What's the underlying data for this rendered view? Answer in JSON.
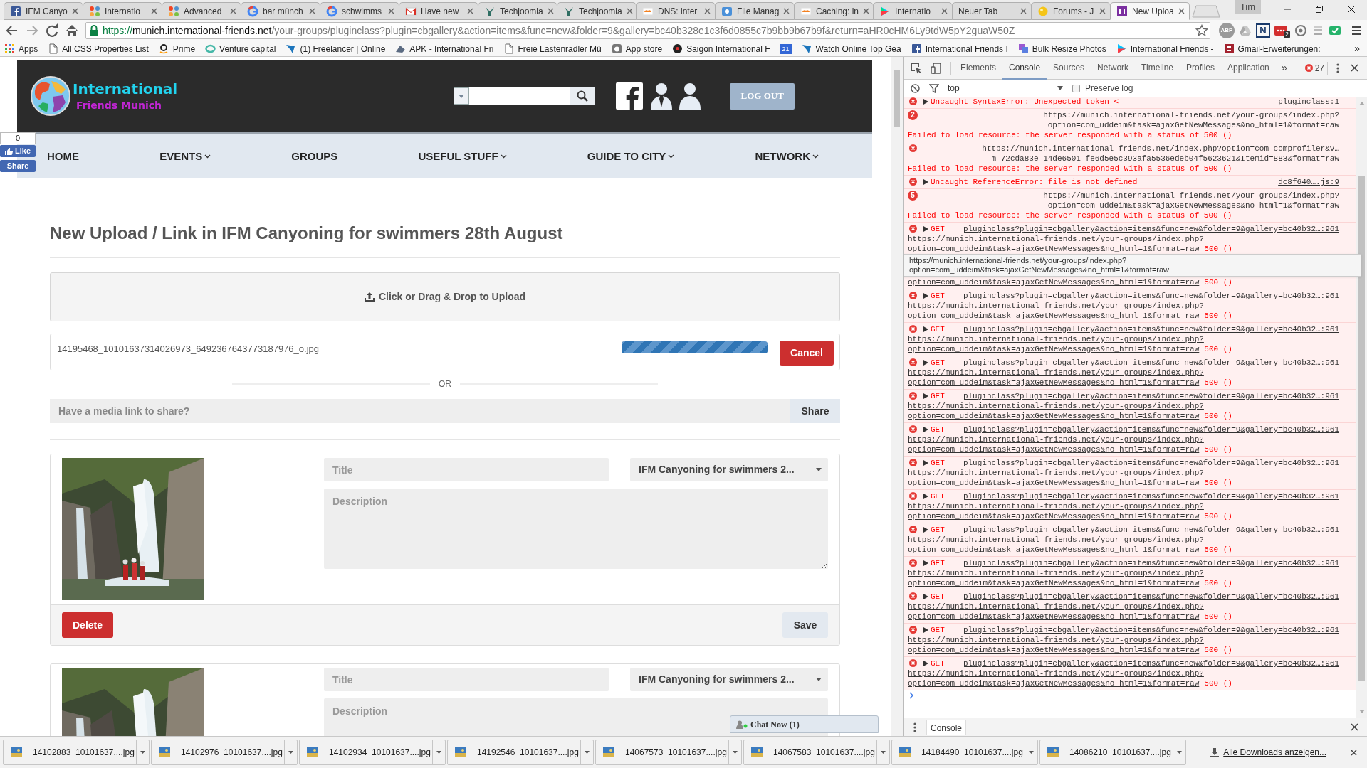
{
  "browser": {
    "tabs": [
      {
        "title": "IFM Canyo",
        "selected": false
      },
      {
        "title": "Internatio",
        "selected": false
      },
      {
        "title": "Advanced",
        "selected": false
      },
      {
        "title": "bar münch",
        "selected": false
      },
      {
        "title": "schwimms",
        "selected": false
      },
      {
        "title": "Have new",
        "selected": false
      },
      {
        "title": "Techjoomla",
        "selected": false
      },
      {
        "title": "Techjoomla",
        "selected": false
      },
      {
        "title": "DNS: inter",
        "selected": false
      },
      {
        "title": "File Manag",
        "selected": false
      },
      {
        "title": "Caching: in",
        "selected": false
      },
      {
        "title": "Internatio",
        "selected": false
      },
      {
        "title": "Neuer Tab",
        "selected": false
      },
      {
        "title": "Forums - J",
        "selected": false
      },
      {
        "title": "New Uploa",
        "selected": true
      }
    ],
    "profile": "Tim",
    "url": {
      "scheme": "https://",
      "host": "munich.international-friends.net",
      "path": "/your-groups/pluginclass?plugin=cbgallery&action=items&func=new&folder=9&gallery=bc40b328e1c3f6d0855c7b9bb9b67b9f&return=aHR0cHM6Ly9tdW5pY2guaW50Z"
    },
    "extensions": [
      {
        "kind": "abp",
        "label": "ABP"
      },
      {
        "kind": "drive"
      },
      {
        "kind": "letter",
        "label": "N"
      },
      {
        "kind": "badge",
        "badge": "2"
      },
      {
        "kind": "at"
      },
      {
        "kind": "stack"
      },
      {
        "kind": "check"
      }
    ],
    "bookmarks": [
      {
        "kind": "link",
        "label": "Apps"
      },
      {
        "kind": "link",
        "label": "All CSS Properties List"
      },
      {
        "kind": "link",
        "label": "Prime"
      },
      {
        "kind": "link",
        "label": "Venture capital"
      },
      {
        "kind": "link",
        "label": "(1) Freelancer | Online"
      },
      {
        "kind": "link",
        "label": "APK - International Fri"
      },
      {
        "kind": "link",
        "label": "Freie Lastenradler Mü"
      },
      {
        "kind": "link",
        "label": "App store"
      },
      {
        "kind": "link",
        "label": "Saigon International F"
      },
      {
        "kind": "calendar",
        "icon_text": "21"
      },
      {
        "kind": "link",
        "label": "Watch Online Top Gea"
      },
      {
        "kind": "link",
        "label": "International Friends I"
      },
      {
        "kind": "link",
        "label": "Bulk Resize Photos"
      },
      {
        "kind": "link",
        "label": "International Friends -"
      },
      {
        "kind": "link",
        "label": "Gmail-Erweiterungen:"
      }
    ],
    "bookmarks_overflow": "»"
  },
  "page": {
    "logo": {
      "line_1": "International",
      "line_2": "Friends Munich"
    },
    "logout": "LOG OUT",
    "like_widget": {
      "count": "0",
      "like": "Like",
      "share": "Share"
    },
    "nav": [
      {
        "label": "HOME",
        "dropdown": false
      },
      {
        "label": "EVENTS",
        "dropdown": true
      },
      {
        "label": "GROUPS",
        "dropdown": false
      },
      {
        "label": "USEFUL STUFF",
        "dropdown": true
      },
      {
        "label": "GUIDE TO CITY",
        "dropdown": true
      },
      {
        "label": "NETWORK",
        "dropdown": true
      }
    ],
    "title": "New Upload / Link in IFM Canyoning for swimmers 28th August",
    "upload_prompt": "Click or Drag & Drop to Upload",
    "upload": {
      "file": "14195468_10101637314026973_6492367643773187976_o.jpg",
      "level": 1,
      "cancel": "Cancel"
    },
    "or": "OR",
    "link_field": {
      "placeholder": "Have a media link to share?",
      "button": "Share"
    },
    "items": [
      {
        "title_placeholder": "Title",
        "folder": "IFM Canyoning for swimmers 2...",
        "description_placeholder": "Description",
        "delete": "Delete",
        "save": "Save"
      },
      {
        "title_placeholder": "Title",
        "folder": "IFM Canyoning for swimmers 2...",
        "description_placeholder": "Description"
      }
    ],
    "chat": "Chat Now (1)"
  },
  "devtools": {
    "tabs": [
      {
        "label": "Elements",
        "selected": false
      },
      {
        "label": "Console",
        "selected": true
      },
      {
        "label": "Sources",
        "selected": false
      },
      {
        "label": "Network",
        "selected": false
      },
      {
        "label": "Timeline",
        "selected": false
      },
      {
        "label": "Profiles",
        "selected": false
      },
      {
        "label": "Application",
        "selected": false
      }
    ],
    "overflow": "»",
    "error_count": "27",
    "context": "top",
    "preserve_log": {
      "label": "Preserve log",
      "checked": false
    },
    "messages": [
      {
        "kind": "error",
        "message": "Uncaught SyntaxError: Unexpected token <",
        "source": "pluginclass:1"
      },
      {
        "kind": "network",
        "count": "2",
        "url_lines": [
          "https://munich.international-friends.net/your-groups/index.php?",
          "option=com_uddeim&task=ajaxGetNewMessages&no_html=1&format=raw"
        ],
        "message": "Failed to load resource: the server responded with a status of 500 ()"
      },
      {
        "kind": "network",
        "url_lines": [
          "https://munich.international-friends.net/index.php?option=com_comprofiler&v…",
          "m_72cda83e_14de6501_fe6d5e5c393afa5536edeb04f5623621&Itemid=883&format=raw"
        ],
        "message": "Failed to load resource: the server responded with a status of 500 ()"
      },
      {
        "kind": "error",
        "message": "Uncaught ReferenceError: file is not defined",
        "source": "dc8f640….js:9"
      },
      {
        "kind": "network",
        "count": "5",
        "url_lines": [
          "https://munich.international-friends.net/your-groups/index.php?",
          "option=com_uddeim&task=ajaxGetNewMessages&no_html=1&format=raw"
        ],
        "message": "Failed to load resource: the server responded with a status of 500 ()"
      },
      {
        "kind": "get",
        "method": "GET",
        "source": "pluginclass?plugin=cbgallery&action=items&func=new&folder=9&gallery=bc40b32…:961",
        "url_lines": [
          "https://munich.international-friends.net/your-groups/index.php?",
          "option=com_uddeim&task=ajaxGetNewMessages&no_html=1&format=raw"
        ],
        "status": "500 ()"
      },
      {
        "kind": "get_partial",
        "url_lines": [
          "option=com_uddeim&task=ajaxGetNewMessages&no_html=1&format=raw"
        ],
        "status": "500 ()",
        "tooltip": [
          "https://munich.international-friends.net/your-groups/index.php?",
          "option=com_uddeim&task=ajaxGetNewMessages&no_html=1&format=raw"
        ]
      },
      {
        "kind": "get",
        "method": "GET",
        "source": "pluginclass?plugin=cbgallery&action=items&func=new&folder=9&gallery=bc40b32…:961",
        "url_lines": [
          "https://munich.international-friends.net/your-groups/index.php?",
          "option=com_uddeim&task=ajaxGetNewMessages&no_html=1&format=raw"
        ],
        "status": "500 ()"
      },
      {
        "kind": "get",
        "method": "GET",
        "source": "pluginclass?plugin=cbgallery&action=items&func=new&folder=9&gallery=bc40b32…:961",
        "url_lines": [
          "https://munich.international-friends.net/your-groups/index.php?",
          "option=com_uddeim&task=ajaxGetNewMessages&no_html=1&format=raw"
        ],
        "status": "500 ()"
      },
      {
        "kind": "get",
        "method": "GET",
        "source": "pluginclass?plugin=cbgallery&action=items&func=new&folder=9&gallery=bc40b32…:961",
        "url_lines": [
          "https://munich.international-friends.net/your-groups/index.php?",
          "option=com_uddeim&task=ajaxGetNewMessages&no_html=1&format=raw"
        ],
        "status": "500 ()"
      },
      {
        "kind": "get",
        "method": "GET",
        "source": "pluginclass?plugin=cbgallery&action=items&func=new&folder=9&gallery=bc40b32…:961",
        "url_lines": [
          "https://munich.international-friends.net/your-groups/index.php?",
          "option=com_uddeim&task=ajaxGetNewMessages&no_html=1&format=raw"
        ],
        "status": "500 ()"
      },
      {
        "kind": "get",
        "method": "GET",
        "source": "pluginclass?plugin=cbgallery&action=items&func=new&folder=9&gallery=bc40b32…:961",
        "url_lines": [
          "https://munich.international-friends.net/your-groups/index.php?",
          "option=com_uddeim&task=ajaxGetNewMessages&no_html=1&format=raw"
        ],
        "status": "500 ()"
      },
      {
        "kind": "get",
        "method": "GET",
        "source": "pluginclass?plugin=cbgallery&action=items&func=new&folder=9&gallery=bc40b32…:961",
        "url_lines": [
          "https://munich.international-friends.net/your-groups/index.php?",
          "option=com_uddeim&task=ajaxGetNewMessages&no_html=1&format=raw"
        ],
        "status": "500 ()"
      },
      {
        "kind": "get",
        "method": "GET",
        "source": "pluginclass?plugin=cbgallery&action=items&func=new&folder=9&gallery=bc40b32…:961",
        "url_lines": [
          "https://munich.international-friends.net/your-groups/index.php?",
          "option=com_uddeim&task=ajaxGetNewMessages&no_html=1&format=raw"
        ],
        "status": "500 ()"
      },
      {
        "kind": "get",
        "method": "GET",
        "source": "pluginclass?plugin=cbgallery&action=items&func=new&folder=9&gallery=bc40b32…:961",
        "url_lines": [
          "https://munich.international-friends.net/your-groups/index.php?",
          "option=com_uddeim&task=ajaxGetNewMessages&no_html=1&format=raw"
        ],
        "status": "500 ()"
      },
      {
        "kind": "get",
        "method": "GET",
        "source": "pluginclass?plugin=cbgallery&action=items&func=new&folder=9&gallery=bc40b32…:961",
        "url_lines": [
          "https://munich.international-friends.net/your-groups/index.php?",
          "option=com_uddeim&task=ajaxGetNewMessages&no_html=1&format=raw"
        ],
        "status": "500 ()"
      },
      {
        "kind": "get",
        "method": "GET",
        "source": "pluginclass?plugin=cbgallery&action=items&func=new&folder=9&gallery=bc40b32…:961",
        "url_lines": [
          "https://munich.international-friends.net/your-groups/index.php?",
          "option=com_uddeim&task=ajaxGetNewMessages&no_html=1&format=raw"
        ],
        "status": "500 ()"
      },
      {
        "kind": "get",
        "method": "GET",
        "source": "pluginclass?plugin=cbgallery&action=items&func=new&folder=9&gallery=bc40b32…:961",
        "url_lines": [
          "https://munich.international-friends.net/your-groups/index.php?",
          "option=com_uddeim&task=ajaxGetNewMessages&no_html=1&format=raw"
        ],
        "status": "500 ()"
      },
      {
        "kind": "get",
        "method": "GET",
        "source": "pluginclass?plugin=cbgallery&action=items&func=new&folder=9&gallery=bc40b32…:961",
        "url_lines": [
          "https://munich.international-friends.net/your-groups/index.php?",
          "option=com_uddeim&task=ajaxGetNewMessages&no_html=1&format=raw"
        ],
        "status": "500 ()"
      }
    ],
    "drawer_tab": "Console"
  },
  "downloads": {
    "items": [
      "14102883_10101637....jpg",
      "14102976_10101637....jpg",
      "14102934_10101637....jpg",
      "14192546_10101637....jpg",
      "14067573_10101637....jpg",
      "14067583_10101637....jpg",
      "14184490_10101637....jpg",
      "14086210_10101637....jpg"
    ],
    "show_all": "Alle Downloads anzeigen..."
  }
}
